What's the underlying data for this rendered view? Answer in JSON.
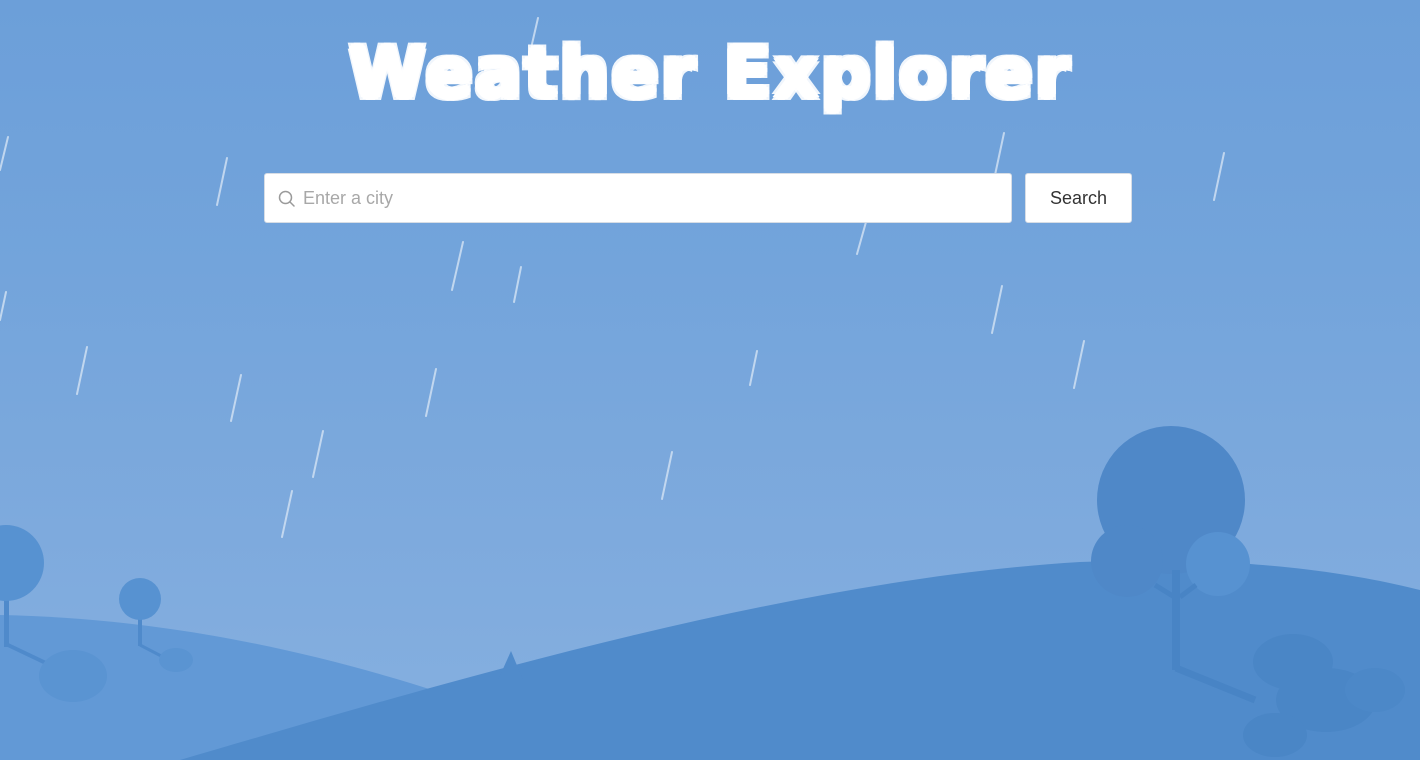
{
  "app": {
    "title": "Weather Explorer"
  },
  "search": {
    "placeholder": "Enter a city",
    "value": "",
    "button_label": "Search",
    "icon": "search-icon"
  },
  "colors": {
    "sky_top": "#6c9fd9",
    "sky_bottom": "#86b0e0",
    "hill_front": "#508bcb",
    "hill_back": "#6299d6",
    "tree": "#4f8acb",
    "rain": "#c9dcf1"
  }
}
